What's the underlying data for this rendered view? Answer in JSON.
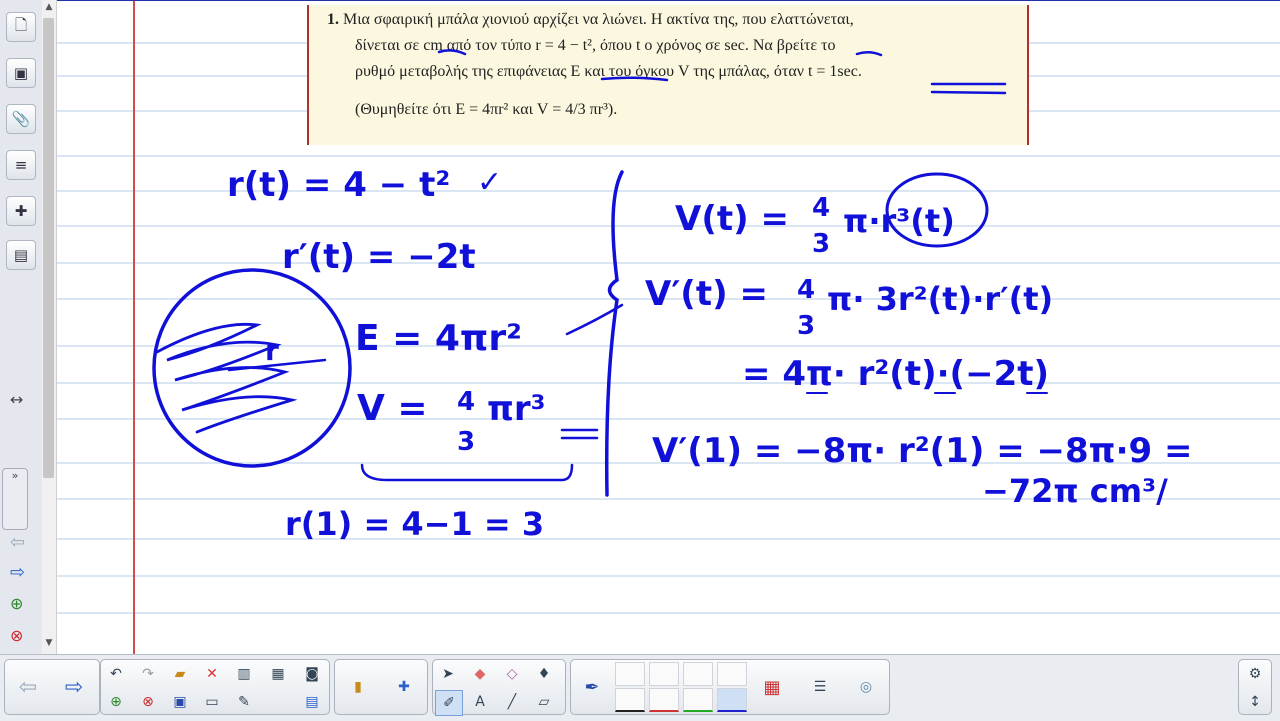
{
  "problem": {
    "number": "1.",
    "line1": "Μια σφαιρική μπάλα χιονιού αρχίζει να λιώνει. Η ακτίνα της, που ελαττώνεται,",
    "line2": "δίνεται σε cm από τον τύπο r = 4 − t², όπου t ο χρόνος σε sec. Να βρείτε το",
    "line3": "ρυθμό μεταβολής της επιφάνειας E και του όγκου V της μπάλας, όταν t = 1sec.",
    "hint": "(Θυμηθείτε ότι E = 4πr² και V = 4/3 πr³)."
  },
  "handwriting": {
    "h1": "r(t) = 4 − t²",
    "h1check": "✓",
    "h2": "r′(t) = −2t",
    "circle_label": "r",
    "h3": "E = 4πr²",
    "h4v": "V =",
    "h4num": "4",
    "h4den": "3",
    "h4rest": "πr³",
    "h5": "r(1) = 4−1 = 3",
    "v1": "V(t) =",
    "v1num": "4",
    "v1den": "3",
    "v1rest": "π·r³(t)",
    "v2": "V′(t) =",
    "v2num": "4",
    "v2den": "3",
    "v2rest": "π· 3r²(t)·r′(t)",
    "v3": "= 4π· r²(t)·(−2t)",
    "v4": "V′(1) = −8π· r²(1) = −8π·9 =",
    "v5": "−72π cm³/"
  },
  "colors": {
    "ink": "#1010d8",
    "margin": "#d44a4a",
    "ruling": "#c3d6ec",
    "note_bg": "#fbf8df"
  },
  "sidebar": {
    "icons": [
      "page-sorter-icon",
      "gallery-icon",
      "attachments-icon",
      "properties-icon",
      "addons-icon",
      "notebook-icon"
    ],
    "resize": "↔"
  },
  "toolbar": {
    "left_icons": [
      "back-arrow-icon",
      "forward-arrow-icon",
      "undo-icon",
      "redo-icon",
      "open-file-icon",
      "delete-icon",
      "screen-shade-icon",
      "table-icon",
      "camera-icon",
      "add-page-icon",
      "remove-page-icon",
      "save-icon",
      "display-icon",
      "pen-recognition-icon",
      "record-icon"
    ],
    "right_icons": [
      "settings-icon",
      "move-toolbar-icon"
    ]
  }
}
